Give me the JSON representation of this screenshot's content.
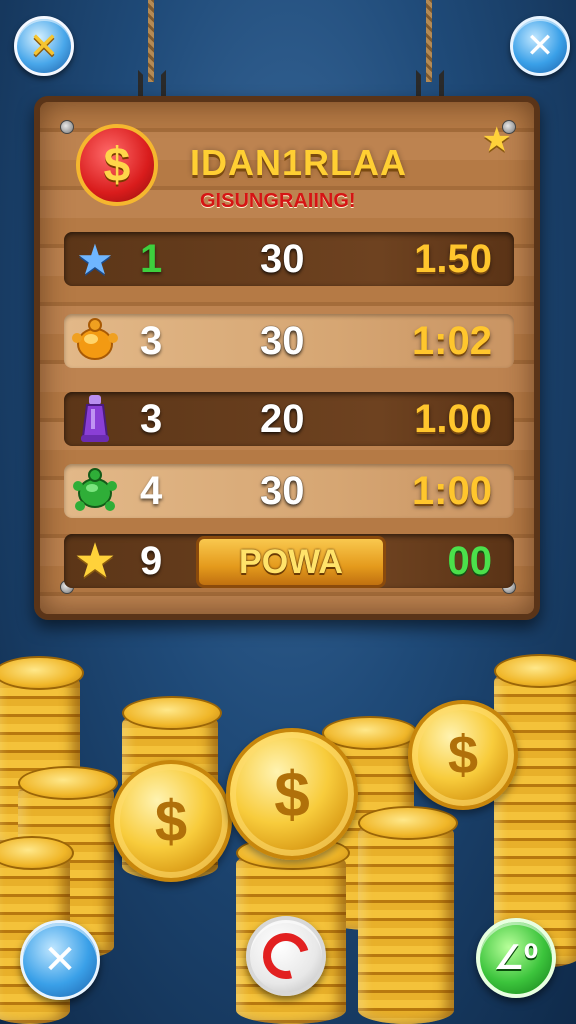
{
  "header": {
    "title": "IDAN1RLAA",
    "subtitle": "GISUNGRAIING!",
    "left_button_icon": "crossed-swords-icon",
    "right_button_icon": "close-icon",
    "coin_symbol": "$"
  },
  "rows": [
    {
      "icon": "blue-star-icon",
      "count": "1",
      "count_color": "#3ecf3e",
      "mid": "30",
      "value": "1.50",
      "value_style": "gold"
    },
    {
      "icon": "orange-turtle-icon",
      "count": "3",
      "count_color": "#ffffff",
      "mid": "30",
      "value": "1:02",
      "value_style": "gold"
    },
    {
      "icon": "purple-bottle-icon",
      "count": "3",
      "count_color": "#ffffff",
      "mid": "20",
      "value": "1.00",
      "value_style": "gold"
    },
    {
      "icon": "green-turtle-icon",
      "count": "4",
      "count_color": "#ffffff",
      "mid": "30",
      "value": "1:00",
      "value_style": "gold"
    },
    {
      "icon": "gold-star-icon",
      "count": "9",
      "count_color": "#ffffff",
      "mid": "",
      "value": "00",
      "value_style": "green",
      "button_label": "POWA"
    }
  ],
  "bottom": {
    "left_icon": "close-icon",
    "center_icon": "refresh-icon",
    "right_label": "∠⁰",
    "coin_symbol": "$"
  },
  "colors": {
    "gold": "#ffc62d",
    "green": "#4be04b",
    "red": "#d51414"
  }
}
